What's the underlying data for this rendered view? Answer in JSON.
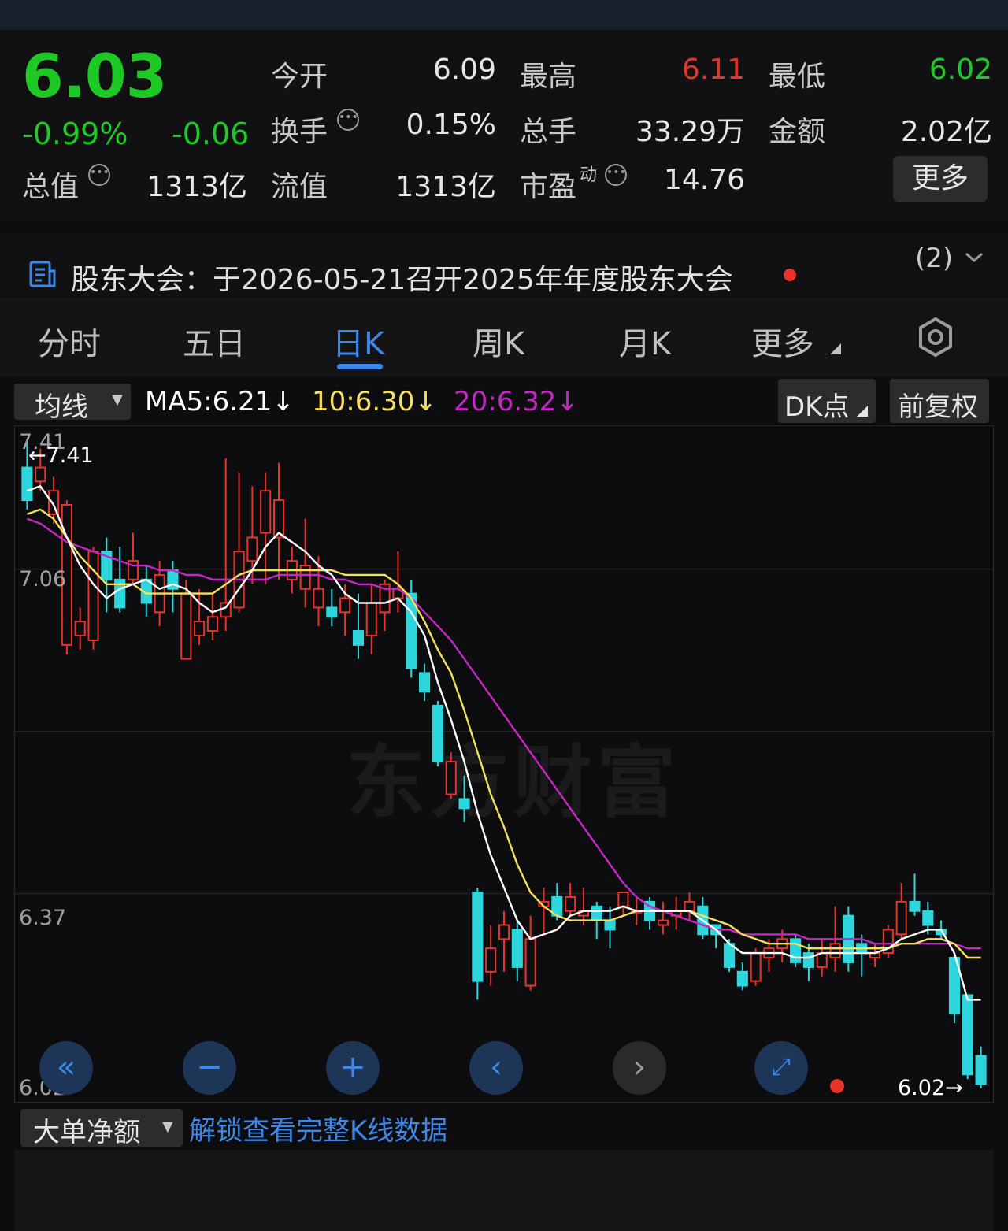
{
  "quote": {
    "price": "6.03",
    "change_pct": "-0.99%",
    "change": "-0.06",
    "open_label": "今开",
    "open": "6.09",
    "high_label": "最高",
    "high": "6.11",
    "low_label": "最低",
    "low": "6.02",
    "turnover_label": "换手",
    "turnover": "0.15%",
    "volume_label": "总手",
    "volume": "33.29万",
    "amount_label": "金额",
    "amount": "2.02亿",
    "mktcap_label": "总值",
    "mktcap": "1313亿",
    "float_label": "流值",
    "float": "1313亿",
    "pe_label": "市盈",
    "pe_sup": "动",
    "pe": "14.76",
    "more_label": "更多"
  },
  "notice": {
    "text": "股东大会：于2026-05-21召开2025年年度股东大会",
    "count": "(2)"
  },
  "tabs": [
    "分时",
    "五日",
    "日K",
    "周K",
    "月K",
    "更多"
  ],
  "active_tab": "日K",
  "ma_bar": {
    "selector": "均线",
    "ma5": "MA5:6.21↓",
    "ma10": "10:6.30↓",
    "ma20": "20:6.32↓",
    "dk_label": "DK点",
    "adjust_label": "前复权"
  },
  "colors": {
    "up": "#e8332a",
    "down": "#2dd6dc",
    "ma5": "#ffffff",
    "ma10": "#f5e05a",
    "ma20": "#c526c5",
    "accent": "#3f87e6"
  },
  "chart_data": {
    "type": "candlestick",
    "y_axis_labels": [
      "7.41",
      "7.06",
      "6.37",
      "6.02"
    ],
    "ylim": [
      6.02,
      7.41
    ],
    "max_marker": "←7.41",
    "min_marker": "6.02→",
    "watermark": "东方财富",
    "candles": [
      [
        7.35,
        7.28,
        7.41,
        7.26
      ],
      [
        7.32,
        7.35,
        7.39,
        7.3
      ],
      [
        7.25,
        7.3,
        7.33,
        7.23
      ],
      [
        6.97,
        7.27,
        7.28,
        6.95
      ],
      [
        6.99,
        7.02,
        7.05,
        6.96
      ],
      [
        6.98,
        7.17,
        7.18,
        6.96
      ],
      [
        7.17,
        7.11,
        7.2,
        7.04
      ],
      [
        7.11,
        7.05,
        7.18,
        7.04
      ],
      [
        7.11,
        7.15,
        7.21,
        7.1
      ],
      [
        7.11,
        7.06,
        7.14,
        7.03
      ],
      [
        7.04,
        7.12,
        7.15,
        7.01
      ],
      [
        7.13,
        7.09,
        7.15,
        7.04
      ],
      [
        6.94,
        7.08,
        7.11,
        6.94
      ],
      [
        6.99,
        7.02,
        7.09,
        6.97
      ],
      [
        7.0,
        7.03,
        7.08,
        6.98
      ],
      [
        7.03,
        7.06,
        7.37,
        7.0
      ],
      [
        7.05,
        7.17,
        7.34,
        7.04
      ],
      [
        7.15,
        7.2,
        7.31,
        7.1
      ],
      [
        7.21,
        7.3,
        7.34,
        7.1
      ],
      [
        7.2,
        7.28,
        7.36,
        7.11
      ],
      [
        7.11,
        7.15,
        7.18,
        7.08
      ],
      [
        7.09,
        7.14,
        7.24,
        7.05
      ],
      [
        7.05,
        7.09,
        7.16,
        7.01
      ],
      [
        7.05,
        7.03,
        7.09,
        7.01
      ],
      [
        7.04,
        7.07,
        7.1,
        6.99
      ],
      [
        7.0,
        6.97,
        7.08,
        6.94
      ],
      [
        6.99,
        7.06,
        7.1,
        6.95
      ],
      [
        7.04,
        7.1,
        7.11,
        7.0
      ],
      [
        7.07,
        7.09,
        7.17,
        7.04
      ],
      [
        7.08,
        6.92,
        7.11,
        6.9
      ],
      [
        6.91,
        6.87,
        6.93,
        6.85
      ],
      [
        6.84,
        6.72,
        6.85,
        6.71
      ],
      [
        6.65,
        6.72,
        6.74,
        6.64
      ],
      [
        6.64,
        6.62,
        6.69,
        6.59
      ],
      [
        6.44,
        6.25,
        6.45,
        6.21
      ],
      [
        6.27,
        6.32,
        6.37,
        6.24
      ],
      [
        6.34,
        6.37,
        6.4,
        6.27
      ],
      [
        6.36,
        6.28,
        6.38,
        6.25
      ],
      [
        6.24,
        6.34,
        6.39,
        6.23
      ],
      [
        6.41,
        6.42,
        6.45,
        6.35
      ],
      [
        6.43,
        6.39,
        6.46,
        6.38
      ],
      [
        6.4,
        6.43,
        6.46,
        6.39
      ],
      [
        6.39,
        6.4,
        6.45,
        6.37
      ],
      [
        6.41,
        6.38,
        6.42,
        6.34
      ],
      [
        6.38,
        6.36,
        6.41,
        6.32
      ],
      [
        6.41,
        6.44,
        6.44,
        6.39
      ],
      [
        6.4,
        6.4,
        6.43,
        6.37
      ],
      [
        6.42,
        6.38,
        6.43,
        6.36
      ],
      [
        6.37,
        6.38,
        6.42,
        6.35
      ],
      [
        6.39,
        6.4,
        6.43,
        6.36
      ],
      [
        6.4,
        6.42,
        6.44,
        6.38
      ],
      [
        6.41,
        6.35,
        6.43,
        6.34
      ],
      [
        6.37,
        6.35,
        6.37,
        6.32
      ],
      [
        6.33,
        6.28,
        6.34,
        6.27
      ],
      [
        6.27,
        6.24,
        6.29,
        6.23
      ],
      [
        6.25,
        6.31,
        6.32,
        6.24
      ],
      [
        6.3,
        6.32,
        6.34,
        6.27
      ],
      [
        6.32,
        6.34,
        6.36,
        6.29
      ],
      [
        6.34,
        6.29,
        6.35,
        6.28
      ],
      [
        6.31,
        6.28,
        6.33,
        6.25
      ],
      [
        6.28,
        6.31,
        6.34,
        6.26
      ],
      [
        6.3,
        6.33,
        6.41,
        6.27
      ],
      [
        6.39,
        6.29,
        6.41,
        6.27
      ],
      [
        6.33,
        6.31,
        6.35,
        6.26
      ],
      [
        6.3,
        6.31,
        6.33,
        6.28
      ],
      [
        6.31,
        6.36,
        6.37,
        6.3
      ],
      [
        6.35,
        6.42,
        6.46,
        6.34
      ],
      [
        6.42,
        6.4,
        6.48,
        6.39
      ],
      [
        6.4,
        6.37,
        6.42,
        6.35
      ],
      [
        6.36,
        6.35,
        6.38,
        6.34
      ],
      [
        6.3,
        6.18,
        6.31,
        6.16
      ],
      [
        6.22,
        6.05,
        6.22,
        6.04
      ],
      [
        6.09,
        6.03,
        6.11,
        6.02
      ]
    ],
    "ma5": [
      7.3,
      7.31,
      7.27,
      7.2,
      7.14,
      7.1,
      7.07,
      7.09,
      7.1,
      7.11,
      7.09,
      7.1,
      7.09,
      7.06,
      7.04,
      7.05,
      7.09,
      7.13,
      7.18,
      7.21,
      7.19,
      7.17,
      7.14,
      7.12,
      7.08,
      7.06,
      7.06,
      7.06,
      7.07,
      7.04,
      6.99,
      6.89,
      6.81,
      6.72,
      6.61,
      6.52,
      6.45,
      6.38,
      6.34,
      6.35,
      6.36,
      6.39,
      6.4,
      6.4,
      6.4,
      6.41,
      6.4,
      6.4,
      6.4,
      6.4,
      6.4,
      6.38,
      6.36,
      6.33,
      6.31,
      6.31,
      6.31,
      6.31,
      6.3,
      6.3,
      6.31,
      6.31,
      6.31,
      6.31,
      6.31,
      6.32,
      6.34,
      6.35,
      6.36,
      6.36,
      6.31,
      6.21,
      6.21
    ],
    "ma10": [
      7.25,
      7.26,
      7.24,
      7.2,
      7.16,
      7.13,
      7.1,
      7.1,
      7.1,
      7.08,
      7.08,
      7.08,
      7.08,
      7.08,
      7.08,
      7.1,
      7.12,
      7.13,
      7.13,
      7.13,
      7.13,
      7.13,
      7.13,
      7.13,
      7.12,
      7.12,
      7.12,
      7.12,
      7.1,
      7.07,
      7.02,
      6.96,
      6.91,
      6.83,
      6.74,
      6.65,
      6.58,
      6.5,
      6.44,
      6.41,
      6.39,
      6.38,
      6.38,
      6.38,
      6.38,
      6.39,
      6.4,
      6.4,
      6.4,
      6.4,
      6.4,
      6.39,
      6.38,
      6.37,
      6.35,
      6.34,
      6.33,
      6.33,
      6.33,
      6.32,
      6.32,
      6.32,
      6.32,
      6.32,
      6.32,
      6.32,
      6.33,
      6.33,
      6.34,
      6.34,
      6.33,
      6.3,
      6.3
    ],
    "ma20": [
      7.24,
      7.23,
      7.21,
      7.19,
      7.18,
      7.17,
      7.16,
      7.15,
      7.14,
      7.14,
      7.13,
      7.13,
      7.12,
      7.12,
      7.11,
      7.11,
      7.11,
      7.11,
      7.11,
      7.12,
      7.12,
      7.12,
      7.12,
      7.11,
      7.11,
      7.1,
      7.1,
      7.09,
      7.09,
      7.07,
      7.04,
      7.01,
      6.98,
      6.94,
      6.9,
      6.86,
      6.82,
      6.78,
      6.74,
      6.7,
      6.66,
      6.62,
      6.58,
      6.54,
      6.5,
      6.46,
      6.43,
      6.41,
      6.4,
      6.39,
      6.38,
      6.37,
      6.36,
      6.36,
      6.35,
      6.35,
      6.35,
      6.35,
      6.35,
      6.34,
      6.34,
      6.34,
      6.34,
      6.34,
      6.33,
      6.33,
      6.33,
      6.33,
      6.33,
      6.33,
      6.33,
      6.32,
      6.32
    ]
  },
  "chart_controls": [
    "double-chevron-left-icon",
    "zoom-out-icon",
    "zoom-in-icon",
    "chevron-left-icon",
    "chevron-right-icon",
    "fullscreen-icon"
  ],
  "bottom": {
    "selector": "大单净额",
    "unlock": "解锁查看完整K线数据"
  }
}
